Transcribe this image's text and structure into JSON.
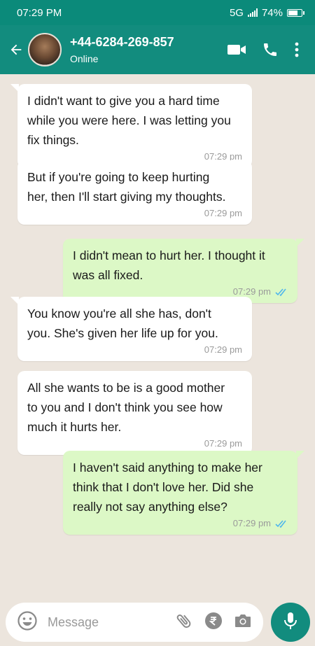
{
  "status_bar": {
    "time": "07:29 PM",
    "network": "5G",
    "battery": "74%",
    "battery_level": 0.74
  },
  "header": {
    "contact_name": "+44-6284-269-857",
    "contact_status": "Online",
    "icons": [
      "back-arrow-icon",
      "video-call-icon",
      "phone-icon",
      "more-vert-icon"
    ]
  },
  "messages": [
    {
      "direction": "in",
      "text": "I didn't want to give you a hard time\nwhile you were here. I was letting you\nfix things.",
      "time": "07:29 pm"
    },
    {
      "direction": "in",
      "text": "But if you're going to keep hurting\nher, then I'll start giving my thoughts.",
      "time": "07:29 pm"
    },
    {
      "direction": "out",
      "text": "I didn't mean to hurt her. I thought it\nwas all fixed.",
      "time": "07:29 pm",
      "read": true
    },
    {
      "direction": "in",
      "text": "You know you're all she has, don't\nyou. She's given her life up for you.",
      "time": "07:29 pm"
    },
    {
      "direction": "in",
      "text": "All she wants to be is a good mother\nto you and I don't think you see how\nmuch it hurts her.",
      "time": "07:29 pm"
    },
    {
      "direction": "out",
      "text": "I haven't said anything to make her\nthink that I don't love her. Did she\nreally not say anything else?",
      "time": "07:29 pm",
      "read": true
    }
  ],
  "composer": {
    "placeholder": "Message",
    "icons": [
      "emoji-icon",
      "attach-icon",
      "rupee-payment-icon",
      "camera-icon",
      "mic-icon"
    ]
  },
  "colors": {
    "header": "#128c7e",
    "status_bar": "#0b8a7a",
    "outgoing_bubble": "#dcf8c6",
    "incoming_bubble": "#ffffff",
    "chat_background": "#ece5dd",
    "read_ticks": "#4fb6ec"
  }
}
